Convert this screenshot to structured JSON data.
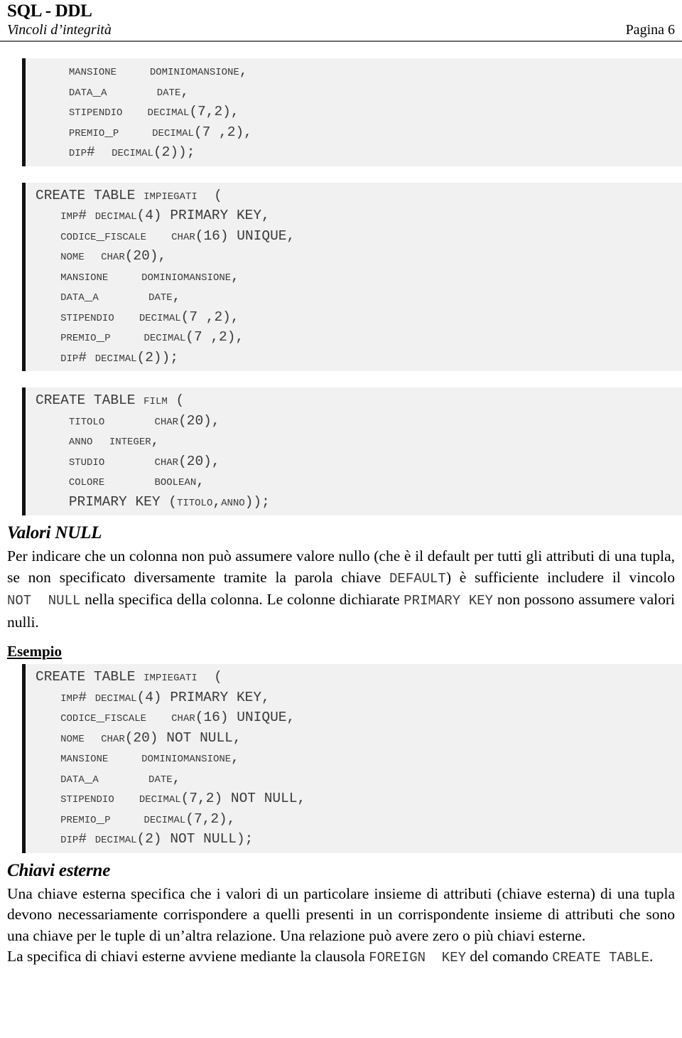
{
  "header": {
    "title": "SQL - DDL",
    "subtitle": "Vincoli d’integrità",
    "page_label": "Pagina 6"
  },
  "code_blocks": {
    "block1": {
      "lines": [
        "    MANSIONE    DOMINIOMANSIONE,",
        "    DATA_A      DATE,",
        "    STIPENDIO   DECIMAL(7,2),",
        "    PREMIO_P    DECIMAL(7 ,2),",
        "    DIP#  DECIMAL(2));"
      ]
    },
    "block2": {
      "lines": [
        "CREATE TABLE IMPIEGATI  (",
        "   IMP# DECIMAL(4) PRIMARY KEY,",
        "   CODICE_FISCALE   CHAR(16) UNIQUE,",
        "   NOME  CHAR(20),",
        "   MANSIONE    DOMINIOMANSIONE,",
        "   DATA_A      DATE,",
        "   STIPENDIO   DECIMAL(7 ,2),",
        "   PREMIO_P    DECIMAL(7 ,2),",
        "   DIP# DECIMAL(2));"
      ]
    },
    "block3": {
      "lines": [
        "CREATE TABLE FILM (",
        "    TITOLO      CHAR(20),",
        "    ANNO  INTEGER,",
        "    STUDIO      CHAR(20),",
        "    COLORE      BOOLEAN,",
        "    PRIMARY KEY (TITOLO,ANNO));"
      ]
    },
    "block4": {
      "lines": [
        "CREATE TABLE IMPIEGATI  (",
        "   IMP# DECIMAL(4) PRIMARY KEY,",
        "   CODICE_FISCALE   CHAR(16) UNIQUE,",
        "   NOME  CHAR(20) NOT NULL,",
        "   MANSIONE    DOMINIOMANSIONE,",
        "   DATA_A      DATE,",
        "   STIPENDIO   DECIMAL(7,2) NOT NULL,",
        "   PREMIO_P    DECIMAL(7,2),",
        "   DIP# DECIMAL(2) NOT NULL);"
      ]
    }
  },
  "sections": {
    "valori_null": {
      "heading": "Valori NULL",
      "para_1": "Per indicare che un colonna non può assumere valore nullo (che è il default per tutti gli attributi di una tupla, se non specificato diversamente tramite la parola chiave ",
      "code_default": "DEFAULT",
      "para_2": ") è sufficiente includere il vincolo ",
      "code_notnull": "NOT  NULL",
      "para_3": " nella specifica della colonna. Le colonne dichiarate ",
      "code_primarykey": "PRIMARY KEY",
      "para_4": " non possono assumere valori nulli."
    },
    "esempio": {
      "heading": "Esempio"
    },
    "chiavi_esterne": {
      "heading": "Chiavi esterne",
      "para_1": "Una chiave esterna specifica che i valori di un particolare insieme di attributi (chiave esterna) di una tupla devono necessariamente corrispondere a quelli presenti in un corrispondente insieme di attributi che sono una chiave per le tuple di un’altra relazione. Una relazione può avere zero o più chiavi esterne.",
      "para_2_a": "La specifica di chiavi esterne avviene mediante la clausola ",
      "code_foreignkey": "FOREIGN  KEY",
      "para_2_b": " del comando ",
      "code_createtable": "CREATE TABLE",
      "para_2_c": "."
    }
  },
  "colors": {
    "code_bg": "#f1f1f1",
    "code_bar": "#111111",
    "code_text": "#3a3a3a",
    "rule": "#6b6b6b",
    "body_text": "#000000"
  }
}
